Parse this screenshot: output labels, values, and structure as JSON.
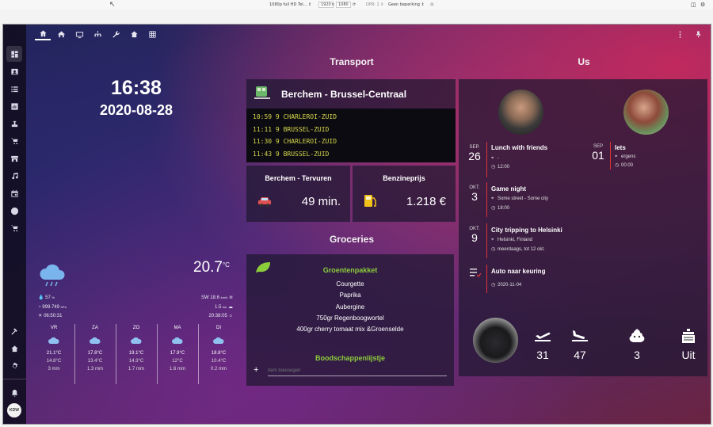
{
  "devbar": {
    "preset": "1080p full HD Tel... ⇕",
    "width": "1920",
    "height": "1080",
    "dpr": "DPR: 1 ⇕",
    "throttle": "Geen beperking ⇕"
  },
  "sidebar": {
    "items": [
      "dashboard-icon",
      "contact-card-icon",
      "list-icon",
      "chart-icon",
      "vacuum-icon",
      "cart-icon",
      "store-icon",
      "music-icon",
      "calendar-icon",
      "compass-icon",
      "cart-icon"
    ],
    "bottom": [
      "hammer-icon",
      "home-gear-icon",
      "gear-icon"
    ],
    "notifications": "bell-icon",
    "user_initials": "KDW"
  },
  "topbar": {
    "tabs": [
      "home-icon",
      "home-variant-icon",
      "television-icon",
      "chandelier-icon",
      "wrench-icon",
      "house-icon",
      "grid-icon"
    ]
  },
  "clock": {
    "time": "16:38",
    "date": "2020-08-28"
  },
  "weather": {
    "temp": "20.7",
    "unit": "°C",
    "humidity": "57",
    "humidity_unit": "%",
    "pressure": "999.749",
    "pressure_unit": "hPa",
    "sunrise": "06:50:31",
    "wind": "SW 18.6",
    "wind_unit": "km/h",
    "visibility": "1.5",
    "visibility_unit": "km",
    "sunset": "20:38:05",
    "forecast": [
      {
        "day": "VR",
        "high": "21.1°C",
        "low": "14.8°C",
        "rain": "3 mm"
      },
      {
        "day": "ZA",
        "high": "17.8°C",
        "low": "13.4°C",
        "rain": "1.3 mm"
      },
      {
        "day": "ZO",
        "high": "19.1°C",
        "low": "14.3°C",
        "rain": "1.7 mm"
      },
      {
        "day": "MA",
        "high": "17.9°C",
        "low": "12°C",
        "rain": "1.6 mm"
      },
      {
        "day": "DI",
        "high": "18.8°C",
        "low": "10.4°C",
        "rain": "0.2 mm"
      }
    ]
  },
  "transport": {
    "title": "Transport",
    "route": "Berchem - Brussel-Centraal",
    "departures": [
      {
        "time": "10:59",
        "track": "9",
        "dest": "CHARLEROI-ZUID"
      },
      {
        "time": "11:11",
        "track": "9",
        "dest": "BRUSSEL-ZUID"
      },
      {
        "time": "11:30",
        "track": "9",
        "dest": "CHARLEROI-ZUID"
      },
      {
        "time": "11:43",
        "track": "9",
        "dest": "BRUSSEL-ZUID"
      }
    ],
    "car_title": "Berchem - Tervuren",
    "car_value": "49 min.",
    "fuel_title": "Benzineprijs",
    "fuel_value": "1.218 €"
  },
  "groceries": {
    "title": "Groceries",
    "package_title": "Groentenpakket",
    "items": [
      "Courgette",
      "Paprika",
      "Aubergine",
      "750gr Regenboogwortel",
      "400gr cherry tomaat mix  &Groenselde"
    ],
    "list_title": "Boodschappenlijstje",
    "add_placeholder": "Item toevoegen"
  },
  "us": {
    "title": "Us",
    "events_left": [
      {
        "month": "SEP.",
        "day": "26",
        "title": "Lunch with friends",
        "location": "-",
        "time": "12:00"
      },
      {
        "month": "OKT.",
        "day": "3",
        "title": "Game night",
        "location": "Some street - Some city",
        "time": "18:00"
      },
      {
        "month": "OKT.",
        "day": "9",
        "title": "City tripping to Helsinki",
        "location": "Helsinki, Finland",
        "time": "meerdaags, tot 12 okt."
      }
    ],
    "events_right": [
      {
        "month": "SEP",
        "day": "01",
        "title": "Iets",
        "location": "ergens",
        "time": "00:00"
      }
    ],
    "task": {
      "title": "Auto naar keuring",
      "date": "2020-11-04"
    },
    "stats": [
      {
        "icon": "plane-takeoff-icon",
        "value": "31"
      },
      {
        "icon": "plane-landing-icon",
        "value": "47"
      },
      {
        "icon": "poop-icon",
        "value": "3"
      },
      {
        "icon": "washing-machine-icon",
        "value": "Uit"
      }
    ]
  },
  "colors": {
    "train_text": "#d6d84a",
    "green": "#8ccd3a",
    "accent_red": "#d33a3a"
  }
}
